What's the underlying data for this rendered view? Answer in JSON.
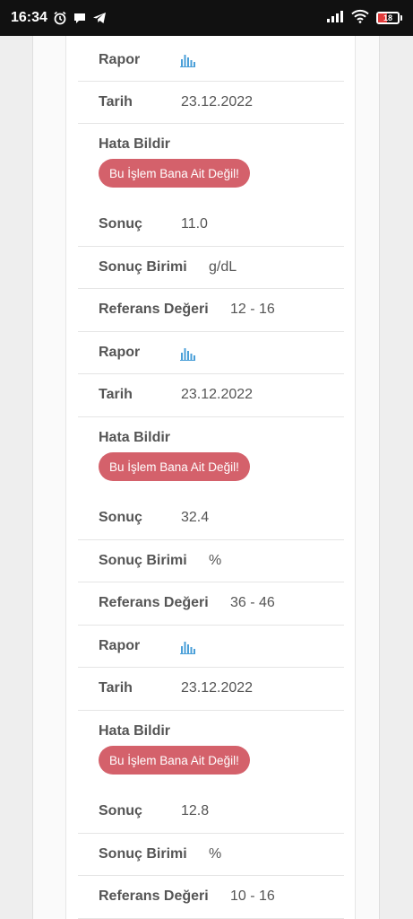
{
  "status_bar": {
    "time": "16:34",
    "battery": "18",
    "icons": [
      "alarm-icon",
      "chat-icon",
      "telegram-icon",
      "signal-icon",
      "wifi-icon",
      "battery-icon"
    ]
  },
  "labels": {
    "rapor": "Rapor",
    "tarih": "Tarih",
    "hata": "Hata Bildir",
    "report_button": "Bu İşlem Bana Ait Değil!",
    "sonuc": "Sonuç",
    "birim": "Sonuç Birimi",
    "referans": "Referans Değeri"
  },
  "results": [
    {
      "tarih": "23.12.2022",
      "sonuc": "11.0",
      "birim": "g/dL",
      "referans": "12 - 16"
    },
    {
      "tarih": "23.12.2022",
      "sonuc": "32.4",
      "birim": "%",
      "referans": "36 - 46"
    },
    {
      "tarih": "23.12.2022",
      "sonuc": "12.8",
      "birim": "%",
      "referans": "10 - 16"
    }
  ],
  "colors": {
    "report_button": "#d4616b",
    "chart_icon": "#4a9fd8",
    "text": "#555555"
  }
}
